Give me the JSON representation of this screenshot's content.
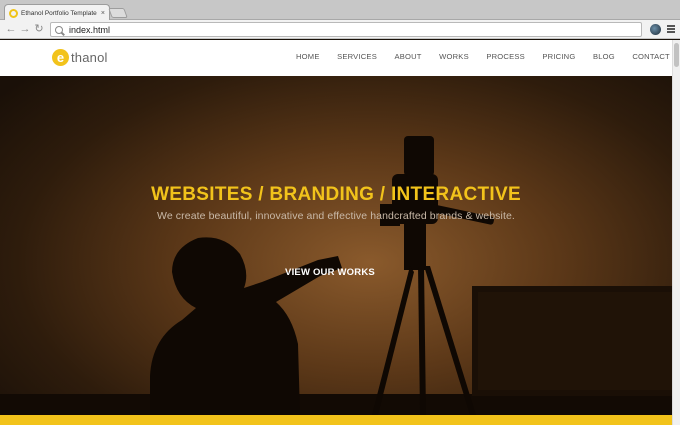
{
  "browser": {
    "tab_title": "Ethanol Portfolio Template",
    "tab_close": "×",
    "url": "index.html",
    "back_glyph": "←",
    "forward_glyph": "→",
    "reload_glyph": "↻"
  },
  "site": {
    "logo_mark": "e",
    "logo_text": "thanol",
    "nav": [
      "HOME",
      "SERVICES",
      "ABOUT",
      "WORKS",
      "PROCESS",
      "PRICING",
      "BLOG",
      "CONTACT"
    ]
  },
  "hero": {
    "title": "WEBSITES / BRANDING / INTERACTIVE",
    "subtitle": "We create beautiful, innovative and effective handcrafted brands & website.",
    "cta": "VIEW OUR WORKS"
  },
  "colors": {
    "accent": "#f2c31b"
  },
  "icons": [
    "favicon-icon",
    "search-icon",
    "extension-icon",
    "menu-icon"
  ]
}
